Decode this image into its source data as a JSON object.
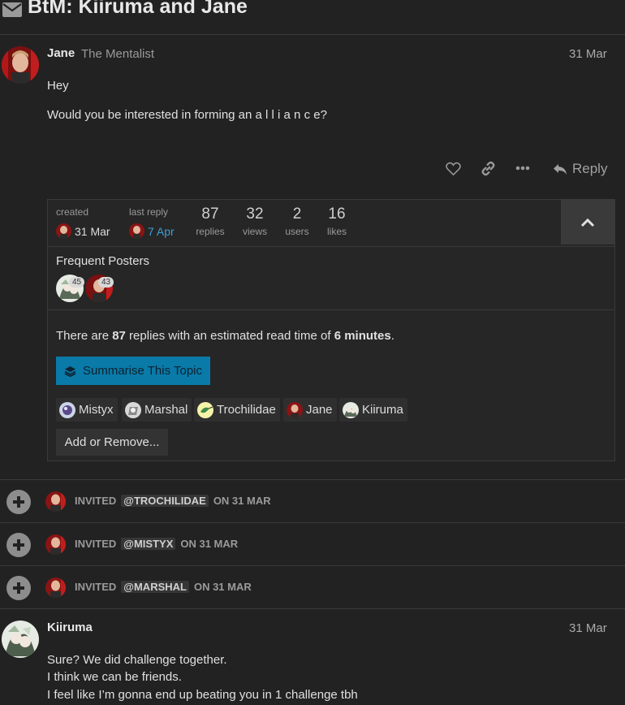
{
  "topic": {
    "title": "BtM: Kiiruma and Jane",
    "icon": "envelope-icon"
  },
  "post1": {
    "username": "Jane",
    "user_title": "The Mentalist",
    "date": "31 Mar",
    "lines": [
      "Hey",
      "Would you be interested in forming an a l l i a n c e?"
    ],
    "actions": {
      "like": "heart-icon",
      "link": "link-icon",
      "more": "ellipsis-icon",
      "reply_label": "Reply"
    }
  },
  "topic_map": {
    "created_label": "created",
    "created_date": "31 Mar",
    "last_reply_label": "last reply",
    "last_reply_date": "7 Apr",
    "replies_value": "87",
    "replies_label": "replies",
    "views_value": "32",
    "views_label": "views",
    "users_value": "2",
    "users_label": "users",
    "likes_value": "16",
    "likes_label": "likes",
    "frequent_posters_label": "Frequent Posters",
    "posters": [
      {
        "count": "45"
      },
      {
        "count": "43"
      }
    ],
    "summary_pre": "There are ",
    "summary_replies": "87",
    "summary_mid": " replies with an estimated read time of ",
    "summary_time": "6 minutes",
    "summary_post": ".",
    "summarise_button": "Summarise This Topic",
    "participants": [
      "Mistyx",
      "Marshal",
      "Trochilidae",
      "Jane",
      "Kiiruma"
    ],
    "add_remove_button": "Add or Remove..."
  },
  "small_actions": [
    {
      "action": "INVITED",
      "mention": "@TROCHILIDAE",
      "when": "ON 31 MAR"
    },
    {
      "action": "INVITED",
      "mention": "@MISTYX",
      "when": "ON 31 MAR"
    },
    {
      "action": "INVITED",
      "mention": "@MARSHAL",
      "when": "ON 31 MAR"
    }
  ],
  "post2": {
    "username": "Kiiruma",
    "date": "31 Mar",
    "lines": [
      "Sure? We did challenge together.",
      "I think we can be friends.",
      "I feel like I’m gonna end up beating you in 1 challenge tbh"
    ]
  },
  "colors": {
    "background": "#222222",
    "accent": "#0a7aa8",
    "link": "#3aa0dc"
  }
}
